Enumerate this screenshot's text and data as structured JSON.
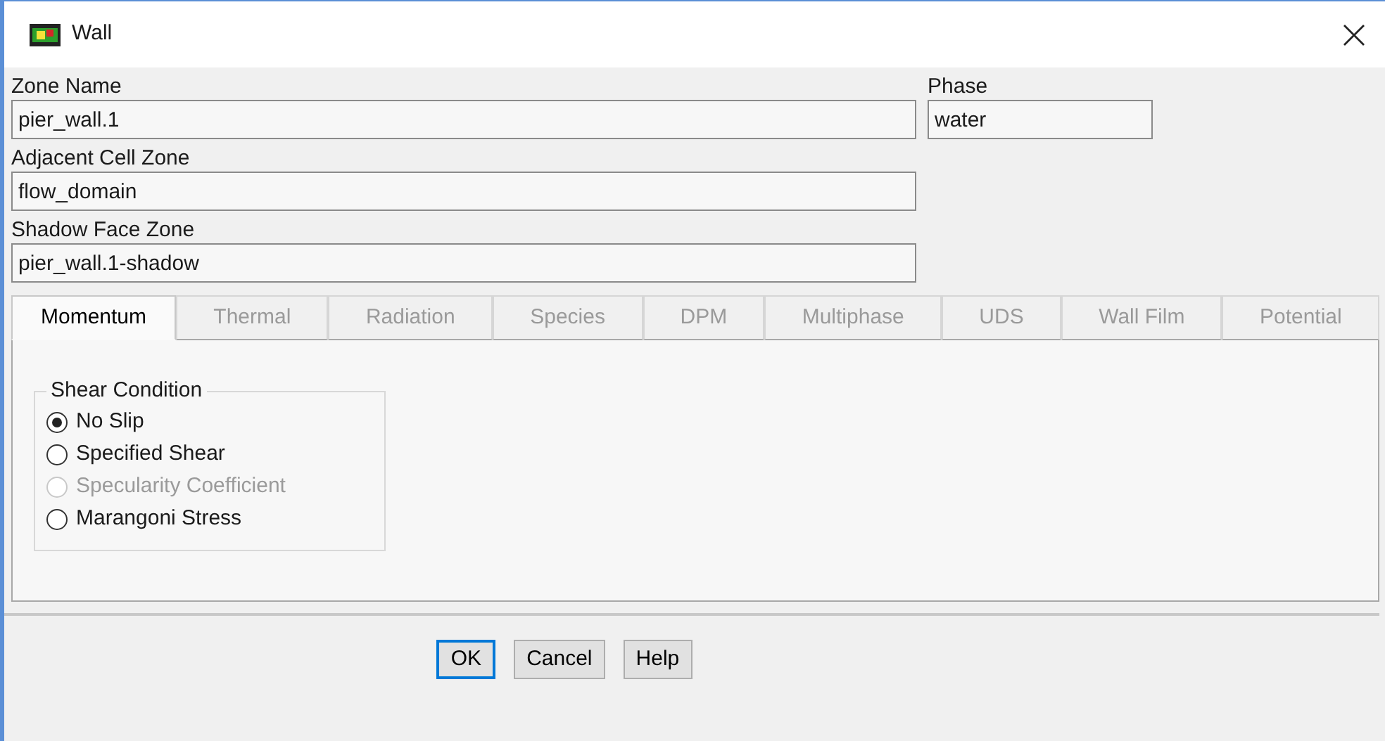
{
  "window": {
    "title": "Wall"
  },
  "fields": {
    "zone_name": {
      "label": "Zone Name",
      "value": "pier_wall.1"
    },
    "phase": {
      "label": "Phase",
      "value": "water"
    },
    "adjacent_cell_zone": {
      "label": "Adjacent Cell Zone",
      "value": "flow_domain"
    },
    "shadow_face_zone": {
      "label": "Shadow Face Zone",
      "value": "pier_wall.1-shadow"
    }
  },
  "tabs": [
    {
      "label": "Momentum",
      "selected": true,
      "disabled": false
    },
    {
      "label": "Thermal",
      "selected": false,
      "disabled": true
    },
    {
      "label": "Radiation",
      "selected": false,
      "disabled": true
    },
    {
      "label": "Species",
      "selected": false,
      "disabled": true
    },
    {
      "label": "DPM",
      "selected": false,
      "disabled": true
    },
    {
      "label": "Multiphase",
      "selected": false,
      "disabled": true
    },
    {
      "label": "UDS",
      "selected": false,
      "disabled": true
    },
    {
      "label": "Wall Film",
      "selected": false,
      "disabled": true
    },
    {
      "label": "Potential",
      "selected": false,
      "disabled": true
    }
  ],
  "shear_condition": {
    "title": "Shear Condition",
    "options": [
      {
        "label": "No Slip",
        "selected": true,
        "disabled": false
      },
      {
        "label": "Specified Shear",
        "selected": false,
        "disabled": false
      },
      {
        "label": "Specularity Coefficient",
        "selected": false,
        "disabled": true
      },
      {
        "label": "Marangoni Stress",
        "selected": false,
        "disabled": false
      }
    ]
  },
  "buttons": [
    {
      "label": "OK",
      "default": true
    },
    {
      "label": "Cancel",
      "default": false
    },
    {
      "label": "Help",
      "default": false
    }
  ]
}
